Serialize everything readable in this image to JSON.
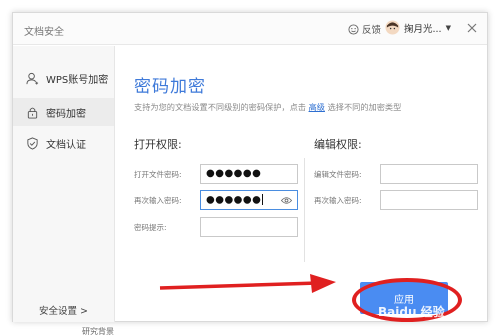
{
  "window": {
    "title": "文档安全",
    "feedback_label": "反馈",
    "user_name": "掬月光...",
    "user_caret": "▼"
  },
  "sidebar": {
    "items": [
      {
        "label": "WPS账号加密",
        "icon": "user-icon"
      },
      {
        "label": "密码加密",
        "icon": "lock-icon",
        "active": true
      },
      {
        "label": "文档认证",
        "icon": "shield-check-icon"
      }
    ],
    "settings_label": "安全设置 >"
  },
  "main": {
    "heading": "密码加密",
    "desc_before": "支持为您的文档设置不同级别的密码保护，点击",
    "desc_link": "高级",
    "desc_after": "选择不同的加密类型",
    "open_section": {
      "title": "打开权限:",
      "password_label": "打开文件密码:",
      "password_value": "●●●●●●",
      "confirm_label": "再次输入密码:",
      "confirm_value": "●●●●●●",
      "hint_label": "密码提示:",
      "hint_value": ""
    },
    "edit_section": {
      "title": "编辑权限:",
      "password_label": "编辑文件密码:",
      "password_value": "",
      "confirm_label": "再次输入密码:",
      "confirm_value": ""
    },
    "apply_label": "应用"
  },
  "overlay": {
    "watermark_text": "Baidu 经验",
    "bottom_text": "研究背景"
  },
  "colors": {
    "accent": "#3f7ad9",
    "apply_button": "#4a8cf2",
    "annotation_red": "#e02020",
    "link": "#2e6fd1"
  }
}
